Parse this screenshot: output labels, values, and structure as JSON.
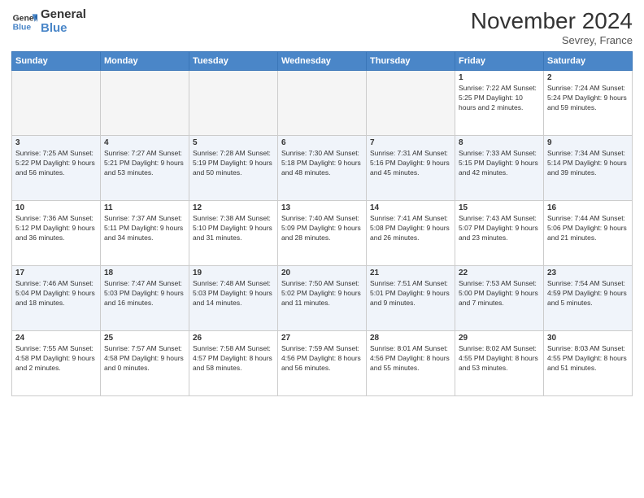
{
  "header": {
    "logo_line1": "General",
    "logo_line2": "Blue",
    "month": "November 2024",
    "location": "Sevrey, France"
  },
  "weekdays": [
    "Sunday",
    "Monday",
    "Tuesday",
    "Wednesday",
    "Thursday",
    "Friday",
    "Saturday"
  ],
  "weeks": [
    [
      {
        "day": "",
        "info": ""
      },
      {
        "day": "",
        "info": ""
      },
      {
        "day": "",
        "info": ""
      },
      {
        "day": "",
        "info": ""
      },
      {
        "day": "",
        "info": ""
      },
      {
        "day": "1",
        "info": "Sunrise: 7:22 AM\nSunset: 5:25 PM\nDaylight: 10 hours\nand 2 minutes."
      },
      {
        "day": "2",
        "info": "Sunrise: 7:24 AM\nSunset: 5:24 PM\nDaylight: 9 hours\nand 59 minutes."
      }
    ],
    [
      {
        "day": "3",
        "info": "Sunrise: 7:25 AM\nSunset: 5:22 PM\nDaylight: 9 hours\nand 56 minutes."
      },
      {
        "day": "4",
        "info": "Sunrise: 7:27 AM\nSunset: 5:21 PM\nDaylight: 9 hours\nand 53 minutes."
      },
      {
        "day": "5",
        "info": "Sunrise: 7:28 AM\nSunset: 5:19 PM\nDaylight: 9 hours\nand 50 minutes."
      },
      {
        "day": "6",
        "info": "Sunrise: 7:30 AM\nSunset: 5:18 PM\nDaylight: 9 hours\nand 48 minutes."
      },
      {
        "day": "7",
        "info": "Sunrise: 7:31 AM\nSunset: 5:16 PM\nDaylight: 9 hours\nand 45 minutes."
      },
      {
        "day": "8",
        "info": "Sunrise: 7:33 AM\nSunset: 5:15 PM\nDaylight: 9 hours\nand 42 minutes."
      },
      {
        "day": "9",
        "info": "Sunrise: 7:34 AM\nSunset: 5:14 PM\nDaylight: 9 hours\nand 39 minutes."
      }
    ],
    [
      {
        "day": "10",
        "info": "Sunrise: 7:36 AM\nSunset: 5:12 PM\nDaylight: 9 hours\nand 36 minutes."
      },
      {
        "day": "11",
        "info": "Sunrise: 7:37 AM\nSunset: 5:11 PM\nDaylight: 9 hours\nand 34 minutes."
      },
      {
        "day": "12",
        "info": "Sunrise: 7:38 AM\nSunset: 5:10 PM\nDaylight: 9 hours\nand 31 minutes."
      },
      {
        "day": "13",
        "info": "Sunrise: 7:40 AM\nSunset: 5:09 PM\nDaylight: 9 hours\nand 28 minutes."
      },
      {
        "day": "14",
        "info": "Sunrise: 7:41 AM\nSunset: 5:08 PM\nDaylight: 9 hours\nand 26 minutes."
      },
      {
        "day": "15",
        "info": "Sunrise: 7:43 AM\nSunset: 5:07 PM\nDaylight: 9 hours\nand 23 minutes."
      },
      {
        "day": "16",
        "info": "Sunrise: 7:44 AM\nSunset: 5:06 PM\nDaylight: 9 hours\nand 21 minutes."
      }
    ],
    [
      {
        "day": "17",
        "info": "Sunrise: 7:46 AM\nSunset: 5:04 PM\nDaylight: 9 hours\nand 18 minutes."
      },
      {
        "day": "18",
        "info": "Sunrise: 7:47 AM\nSunset: 5:03 PM\nDaylight: 9 hours\nand 16 minutes."
      },
      {
        "day": "19",
        "info": "Sunrise: 7:48 AM\nSunset: 5:03 PM\nDaylight: 9 hours\nand 14 minutes."
      },
      {
        "day": "20",
        "info": "Sunrise: 7:50 AM\nSunset: 5:02 PM\nDaylight: 9 hours\nand 11 minutes."
      },
      {
        "day": "21",
        "info": "Sunrise: 7:51 AM\nSunset: 5:01 PM\nDaylight: 9 hours\nand 9 minutes."
      },
      {
        "day": "22",
        "info": "Sunrise: 7:53 AM\nSunset: 5:00 PM\nDaylight: 9 hours\nand 7 minutes."
      },
      {
        "day": "23",
        "info": "Sunrise: 7:54 AM\nSunset: 4:59 PM\nDaylight: 9 hours\nand 5 minutes."
      }
    ],
    [
      {
        "day": "24",
        "info": "Sunrise: 7:55 AM\nSunset: 4:58 PM\nDaylight: 9 hours\nand 2 minutes."
      },
      {
        "day": "25",
        "info": "Sunrise: 7:57 AM\nSunset: 4:58 PM\nDaylight: 9 hours\nand 0 minutes."
      },
      {
        "day": "26",
        "info": "Sunrise: 7:58 AM\nSunset: 4:57 PM\nDaylight: 8 hours\nand 58 minutes."
      },
      {
        "day": "27",
        "info": "Sunrise: 7:59 AM\nSunset: 4:56 PM\nDaylight: 8 hours\nand 56 minutes."
      },
      {
        "day": "28",
        "info": "Sunrise: 8:01 AM\nSunset: 4:56 PM\nDaylight: 8 hours\nand 55 minutes."
      },
      {
        "day": "29",
        "info": "Sunrise: 8:02 AM\nSunset: 4:55 PM\nDaylight: 8 hours\nand 53 minutes."
      },
      {
        "day": "30",
        "info": "Sunrise: 8:03 AM\nSunset: 4:55 PM\nDaylight: 8 hours\nand 51 minutes."
      }
    ]
  ]
}
